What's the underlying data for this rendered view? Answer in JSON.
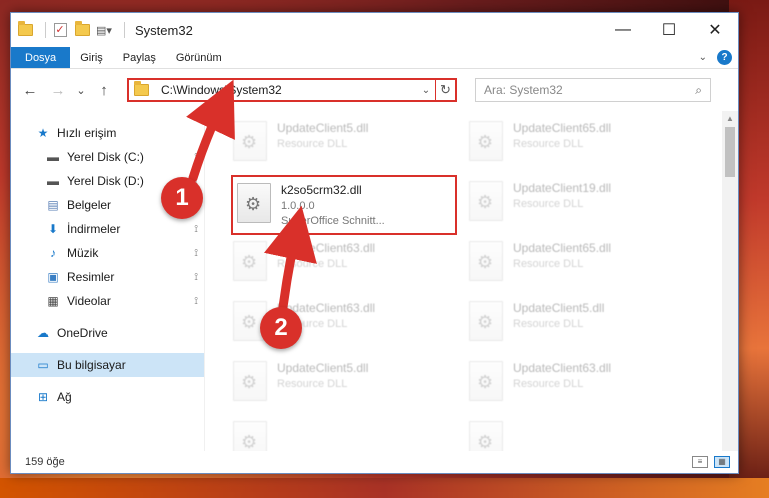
{
  "window": {
    "title": "System32",
    "minimize": "—",
    "maximize": "☐",
    "close": "✕"
  },
  "ribbon": {
    "tabs": [
      "Dosya",
      "Giriş",
      "Paylaş",
      "Görünüm"
    ],
    "expand_icon": "chevron-down",
    "help": "?"
  },
  "nav": {
    "back": "←",
    "forward": "→",
    "recent": "⌄",
    "up": "↑"
  },
  "address": {
    "path": "C:\\Windows\\System32",
    "dropdown": "⌄",
    "refresh": "↻"
  },
  "search": {
    "placeholder": "Ara: System32",
    "icon": "⌕"
  },
  "sidebar": {
    "items": [
      {
        "label": "Hızlı erişim",
        "icon": "star-icon",
        "glyph": "★",
        "color": "#1979ca"
      },
      {
        "label": "Yerel Disk (C:)",
        "icon": "drive-icon",
        "glyph": "▬",
        "color": "#555555",
        "pinned": true
      },
      {
        "label": "Yerel Disk (D:)",
        "icon": "drive-icon",
        "glyph": "▬",
        "color": "#555555",
        "pinned": true
      },
      {
        "label": "Belgeler",
        "icon": "documents-icon",
        "glyph": "▤",
        "color": "#5a7fb5",
        "pinned": true
      },
      {
        "label": "İndirmeler",
        "icon": "download-icon",
        "glyph": "⬇",
        "color": "#1979ca",
        "pinned": true
      },
      {
        "label": "Müzik",
        "icon": "music-icon",
        "glyph": "♪",
        "color": "#1979ca",
        "pinned": true
      },
      {
        "label": "Resimler",
        "icon": "pictures-icon",
        "glyph": "▣",
        "color": "#3a7fc4",
        "pinned": true
      },
      {
        "label": "Videolar",
        "icon": "video-icon",
        "glyph": "▦",
        "color": "#444444",
        "pinned": true
      },
      {
        "label": "OneDrive",
        "icon": "cloud-icon",
        "glyph": "☁",
        "color": "#1979ca"
      },
      {
        "label": "Bu bilgisayar",
        "icon": "computer-icon",
        "glyph": "▭",
        "color": "#1979ca",
        "selected": true
      },
      {
        "label": "Ağ",
        "icon": "network-icon",
        "glyph": "⊞",
        "color": "#1979ca"
      }
    ],
    "pin_glyph": "📌"
  },
  "files": {
    "highlighted": {
      "name": "k2so5crm32.dll",
      "version": "1.0.0.0",
      "description": "SuperOffice Schnitt..."
    },
    "left_column": [
      {
        "name": "UpdateClient5.dll",
        "sub": "Resource DLL"
      },
      {
        "name": "UpdateClient63.dll",
        "sub": "Resource DLL"
      },
      {
        "name": "UpdateClient63.dll",
        "sub": "Resource DLL"
      },
      {
        "name": "UpdateClient5.dll",
        "sub": "Resource DLL"
      },
      {
        "name": "",
        "sub": ""
      }
    ],
    "right_column": [
      {
        "name": "UpdateClient65.dll",
        "sub": "Resource DLL"
      },
      {
        "name": "UpdateClient19.dll",
        "sub": "Resource DLL"
      },
      {
        "name": "UpdateClient65.dll",
        "sub": "Resource DLL"
      },
      {
        "name": "UpdateClient5.dll",
        "sub": "Resource DLL"
      },
      {
        "name": "UpdateClient63.dll",
        "sub": "Resource DLL"
      },
      {
        "name": "",
        "sub": ""
      }
    ]
  },
  "status": {
    "count": "159 öğe"
  },
  "annotations": {
    "step1": "1",
    "step2": "2",
    "color": "#d9302a"
  }
}
